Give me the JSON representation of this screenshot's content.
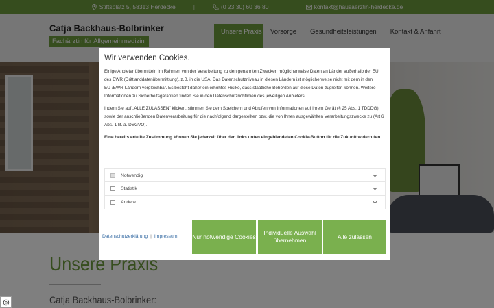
{
  "topbar": {
    "address": "Stiftsplatz 5, 58313 Herdecke",
    "phone": "(0 23 30) 60 36 80",
    "email": "kontakt@hausaerztin-herdecke.de",
    "separator": "|"
  },
  "logo": {
    "name": "Catja Backhaus-Bolbrinker",
    "subtitle": "Fachärztin für Allgemeinmedizin"
  },
  "nav": {
    "items": [
      "Unsere Praxis",
      "Vorsorge",
      "Gesundheitsleistungen",
      "Kontakt & Anfahrt"
    ]
  },
  "main": {
    "title": "Unsere Praxis",
    "subtitle": "Catja Backhaus-Bolbrinker:"
  },
  "cookie": {
    "title": "Wir verwenden Cookies.",
    "p1": "Einige Anbieter übermitteln im Rahmen von der Verarbeitung zu den genannten Zwecken möglicherweise Daten an Länder außerhalb der EU des EWR (Drittlanddatenübermittlung), z.B. in die USA. Das Datenschutzniveau in diesen Ländern ist möglicherweise nicht mit dem in den EU-/EWR-Ländern vergleichbar. Es besteht daher ein erhöhtes Risiko, dass staatliche Behörden auf diese Daten zugreifen können. Weitere Informationen zu Sicherheitsgarantien finden Sie in den Datenschutzrichtlinien des jeweiligen Anbieters.",
    "p2": "Indem Sie auf „ALLE ZULASSEN\" klicken, stimmen Sie dem Speichern und Abrufen von Informationen auf Ihrem Gerät (§ 25 Abs. 1 TDDDG) sowie der anschließenden Datenverarbeitung für die nachfolgend dargestellten bzw. die von Ihnen ausgewählten Verarbeitungszwecke zu (Art 6 Abs. 1 lit. a. DSGVO).",
    "p3": "Eine bereits erteilte Zustimmung können Sie jederzeit über den links unten eingeblendeten Cookie-Button für die Zukunft widerrufen.",
    "categories": [
      {
        "label": "Notwendig",
        "checked": true
      },
      {
        "label": "Statistik",
        "checked": false
      },
      {
        "label": "Andere",
        "checked": false
      }
    ],
    "link_privacy": "Datenschutzerklärung",
    "link_sep": "|",
    "link_imprint": "Impressum",
    "btn_necessary": "Nur notwendige Cookies",
    "btn_individual": "Individuelle Auswahl übernehmen",
    "btn_all": "Alle zulassen"
  },
  "colors": {
    "accent": "#6c9a3d",
    "button": "#7ab04e",
    "link": "#3a6ea5"
  }
}
